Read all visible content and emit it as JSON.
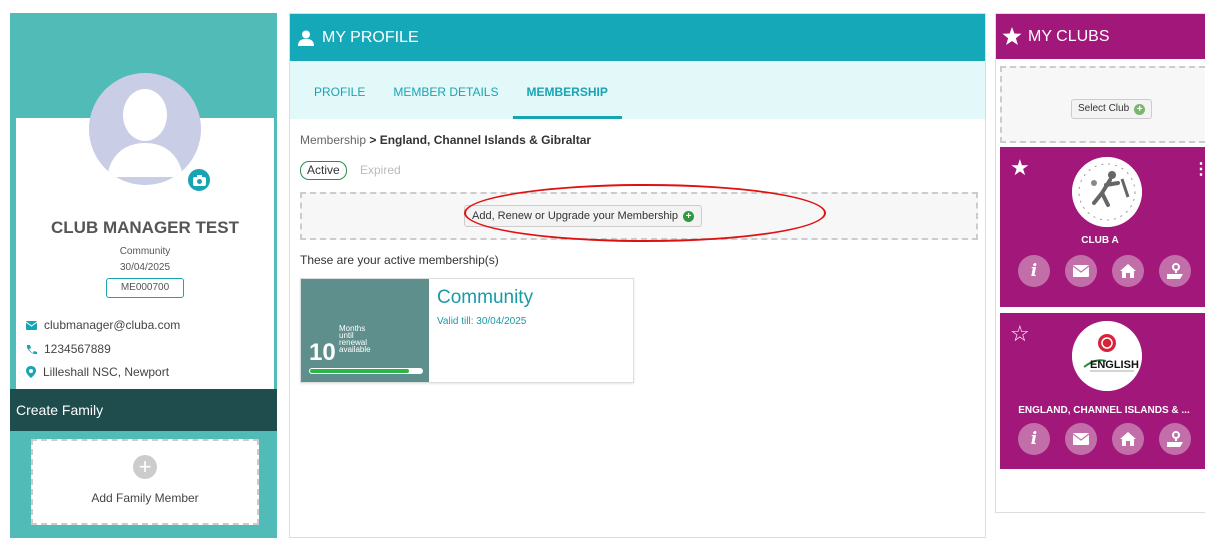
{
  "profile": {
    "name": "CLUB MANAGER TEST",
    "membership_type": "Community",
    "expiry": "30/04/2025",
    "member_id": "ME000700",
    "email": "clubmanager@cluba.com",
    "phone": "1234567889",
    "location": "Lilleshall NSC, Newport"
  },
  "family": {
    "header": "Create Family",
    "add_label": "Add Family Member"
  },
  "main": {
    "title": "MY PROFILE",
    "tabs": [
      {
        "label": "PROFILE"
      },
      {
        "label": "MEMBER DETAILS"
      },
      {
        "label": "MEMBERSHIP"
      }
    ],
    "breadcrumb_root": "Membership",
    "breadcrumb_sep": " > ",
    "breadcrumb_current": "England, Channel Islands & Gibraltar",
    "filter_active": "Active",
    "filter_expired": "Expired",
    "add_button": "Add, Renew or Upgrade your Membership",
    "active_text": "These are your active membership(s)",
    "membership_card": {
      "count": "10",
      "label_lines": [
        "Months",
        "until",
        "renewal",
        "available"
      ],
      "progress": 0.88,
      "title": "Community",
      "valid": "Valid till: 30/04/2025"
    }
  },
  "clubs": {
    "title": "MY CLUBS",
    "select_label": "Select Club",
    "items": [
      {
        "name": "CLUB A",
        "favorite": true
      },
      {
        "name": "ENGLAND, CHANNEL ISLANDS & ...",
        "favorite": false,
        "logo_text": "ENGLISH"
      }
    ],
    "menu_glyph": "⋮"
  },
  "colors": {
    "teal": "#14a8b8",
    "teal_panel": "#51bcb7",
    "dark_teal": "#1f4c4c",
    "purple": "#a1177a",
    "annotation_red": "#e01010"
  }
}
